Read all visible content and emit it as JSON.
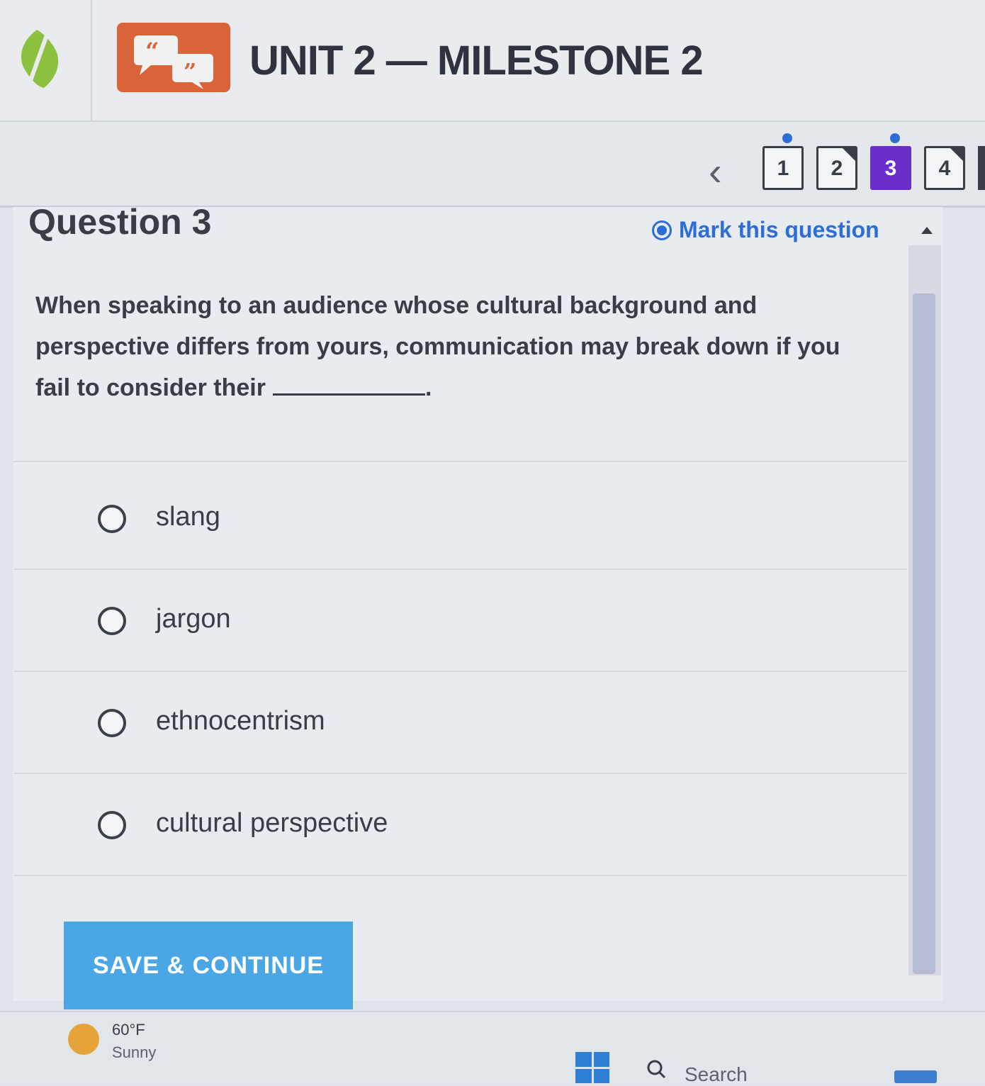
{
  "header": {
    "unit_title": "UNIT 2 — MILESTONE 2",
    "logo_icon": "sophia-leaf-icon",
    "course_icon": "quote-bubbles-icon",
    "accent_color": "#d9643a"
  },
  "question_nav": {
    "prev_icon": "chevron-left-icon",
    "items": [
      {
        "label": "1",
        "state": "answered",
        "marked": true
      },
      {
        "label": "2",
        "state": "answered",
        "marked": false
      },
      {
        "label": "3",
        "state": "active",
        "marked": true
      },
      {
        "label": "4",
        "state": "answered",
        "marked": false
      }
    ],
    "active_color": "#6a2fc9",
    "mark_dot_color": "#2d6ed6"
  },
  "question": {
    "title": "Question 3",
    "mark_label": "Mark this question",
    "mark_selected": true,
    "prompt": "When speaking to an audience whose cultural background and perspective differs from yours, communication may break down if you fail to consider their",
    "prompt_end": "."
  },
  "options": [
    {
      "label": "slang",
      "selected": false
    },
    {
      "label": "jargon",
      "selected": false
    },
    {
      "label": "ethnocentrism",
      "selected": false
    },
    {
      "label": "cultural perspective",
      "selected": false
    }
  ],
  "actions": {
    "save_continue_label": "SAVE & CONTINUE",
    "button_color": "#4aa6e5"
  },
  "taskbar": {
    "temperature": "60°F",
    "condition": "Sunny",
    "weather_icon": "sun-icon",
    "start_icon": "windows-start-icon",
    "search_icon": "search-icon",
    "search_label": "Search"
  }
}
